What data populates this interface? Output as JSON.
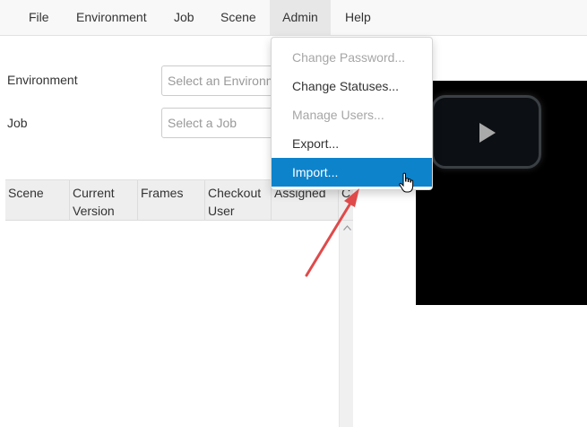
{
  "menubar": {
    "items": [
      {
        "label": "File"
      },
      {
        "label": "Environment"
      },
      {
        "label": "Job"
      },
      {
        "label": "Scene"
      },
      {
        "label": "Admin"
      },
      {
        "label": "Help"
      }
    ]
  },
  "form": {
    "environment": {
      "label": "Environment",
      "placeholder": "Select an Environment"
    },
    "job": {
      "label": "Job",
      "placeholder": "Select a Job"
    }
  },
  "table": {
    "columns": [
      {
        "label": "Scene"
      },
      {
        "label": "Current Version"
      },
      {
        "label": "Frames"
      },
      {
        "label": "Checkout User"
      },
      {
        "label": "Assigned"
      },
      {
        "label": "C"
      }
    ]
  },
  "admin_menu": {
    "items": [
      {
        "label": "Change Password...",
        "state": "disabled"
      },
      {
        "label": "Change Statuses...",
        "state": "enabled"
      },
      {
        "label": "Manage Users...",
        "state": "disabled"
      },
      {
        "label": "Export...",
        "state": "enabled"
      },
      {
        "label": "Import...",
        "state": "highlighted"
      }
    ]
  },
  "colors": {
    "menubar_bg": "#f8f8f8",
    "menu_active_bg": "#e7e7e7",
    "dropdown_highlight": "#0d83cc",
    "annotation_arrow": "#e04a4a",
    "video_bg": "#000000"
  },
  "icons": {
    "play": "play-icon",
    "cursor": "hand-pointer-icon",
    "scroll_up": "chevron-up-icon"
  }
}
